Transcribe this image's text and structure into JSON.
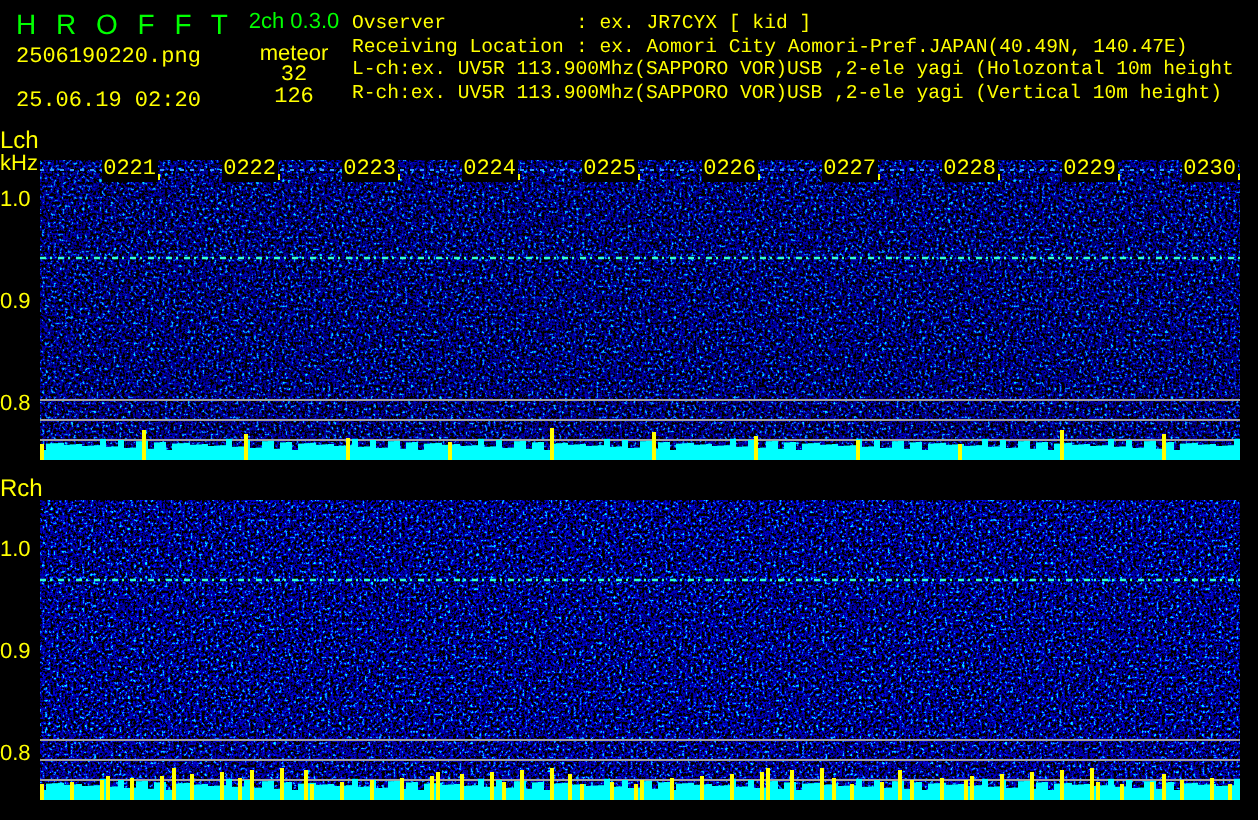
{
  "header": {
    "title": "H R O F F T",
    "version": "2ch 0.3.0",
    "file": "2506190220.png",
    "datetime": "25.06.19 02:20",
    "meteor_label": "meteor",
    "meteor_counts": [
      "32",
      "126"
    ],
    "info": [
      {
        "kind": "field",
        "label": "Ovserver",
        "value": ": ex. JR7CYX [ kid ]"
      },
      {
        "kind": "field",
        "label": "Receiving Location",
        "value": ": ex. Aomori City Aomori-Pref.JAPAN(40.49N, 140.47E)"
      },
      {
        "kind": "line",
        "text": "L-ch:ex. UV5R 113.900Mhz(SAPPORO VOR)USB ,2-ele yagi (Holozontal 10m height"
      },
      {
        "kind": "line",
        "text": "R-ch:ex. UV5R 113.900Mhz(SAPPORO VOR)USB ,2-ele yagi (Vertical 10m height)"
      }
    ]
  },
  "channels": [
    {
      "label": "Lch",
      "unit": "kHz",
      "ticks": [
        "1.0",
        "0.9",
        "0.8"
      ],
      "times": [
        "0221",
        "0222",
        "0223",
        "0224",
        "0225",
        "0226",
        "0227",
        "0228",
        "0229",
        "0230"
      ]
    },
    {
      "label": "Rch",
      "ticks": [
        "1.0",
        "0.9",
        "0.8"
      ]
    }
  ]
}
